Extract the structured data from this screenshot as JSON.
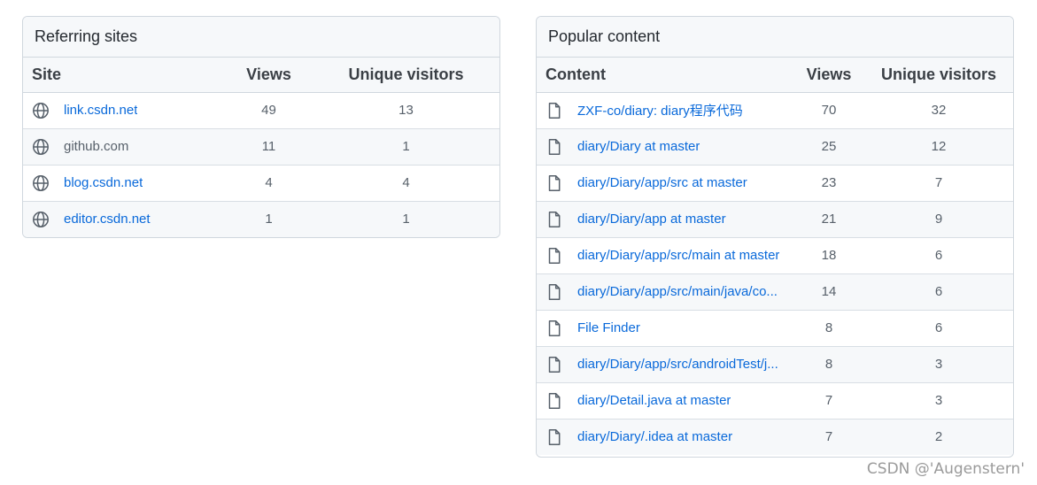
{
  "referring": {
    "title": "Referring sites",
    "headers": {
      "site": "Site",
      "views": "Views",
      "unique": "Unique visitors"
    },
    "rows": [
      {
        "site": "link.csdn.net",
        "views": "49",
        "unique": "13"
      },
      {
        "site": "github.com",
        "views": "11",
        "unique": "1"
      },
      {
        "site": "blog.csdn.net",
        "views": "4",
        "unique": "4"
      },
      {
        "site": "editor.csdn.net",
        "views": "1",
        "unique": "1"
      }
    ]
  },
  "popular": {
    "title": "Popular content",
    "headers": {
      "content": "Content",
      "views": "Views",
      "unique": "Unique visitors"
    },
    "rows": [
      {
        "content": "ZXF-co/diary: diary程序代码",
        "views": "70",
        "unique": "32"
      },
      {
        "content": "diary/Diary at master",
        "views": "25",
        "unique": "12"
      },
      {
        "content": "diary/Diary/app/src at master",
        "views": "23",
        "unique": "7"
      },
      {
        "content": "diary/Diary/app at master",
        "views": "21",
        "unique": "9"
      },
      {
        "content": "diary/Diary/app/src/main at master",
        "views": "18",
        "unique": "6"
      },
      {
        "content": "diary/Diary/app/src/main/java/co...",
        "views": "14",
        "unique": "6"
      },
      {
        "content": "File Finder",
        "views": "8",
        "unique": "6"
      },
      {
        "content": "diary/Diary/app/src/androidTest/j...",
        "views": "8",
        "unique": "3"
      },
      {
        "content": "diary/Detail.java at master",
        "views": "7",
        "unique": "3"
      },
      {
        "content": "diary/Diary/.idea at master",
        "views": "7",
        "unique": "2"
      }
    ]
  },
  "watermark": "CSDN @'Augenstern'",
  "colors": {
    "link": "#0969da",
    "header_bg": "#f6f8fa",
    "border": "#d0d7de"
  },
  "icons": {
    "site": "globe-icon",
    "content": "file-icon"
  }
}
